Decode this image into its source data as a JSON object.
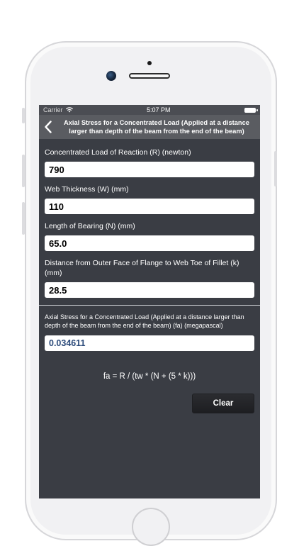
{
  "status_bar": {
    "carrier": "Carrier",
    "time": "5:07 PM",
    "icons": [
      "wifi-icon",
      "battery-icon"
    ]
  },
  "nav": {
    "back_icon": "chevron-left-icon",
    "title": "Axial Stress for a Concentrated Load (Applied at a distance larger than depth of the beam from the end of the beam)"
  },
  "inputs": [
    {
      "label": "Concentrated Load of Reaction (R) (newton)",
      "value": "790"
    },
    {
      "label": "Web Thickness (W) (mm)",
      "value": "110"
    },
    {
      "label": "Length of Bearing (N) (mm)",
      "value": "65.0"
    },
    {
      "label": "Distance from Outer Face of Flange to Web Toe of Fillet (k) (mm)",
      "value": "28.5"
    }
  ],
  "result": {
    "label": "Axial Stress for a Concentrated Load (Applied at a distance larger than depth of the beam from the end of the beam) (fa) (megapascal)",
    "value": "0.034611"
  },
  "formula": "fa = R / (tw * (N + (5 * k)))",
  "clear_label": "Clear",
  "colors": {
    "screen_bg": "#3a3d44",
    "navbar_bg": "#5a5c61",
    "result_text": "#2b4a7a"
  }
}
